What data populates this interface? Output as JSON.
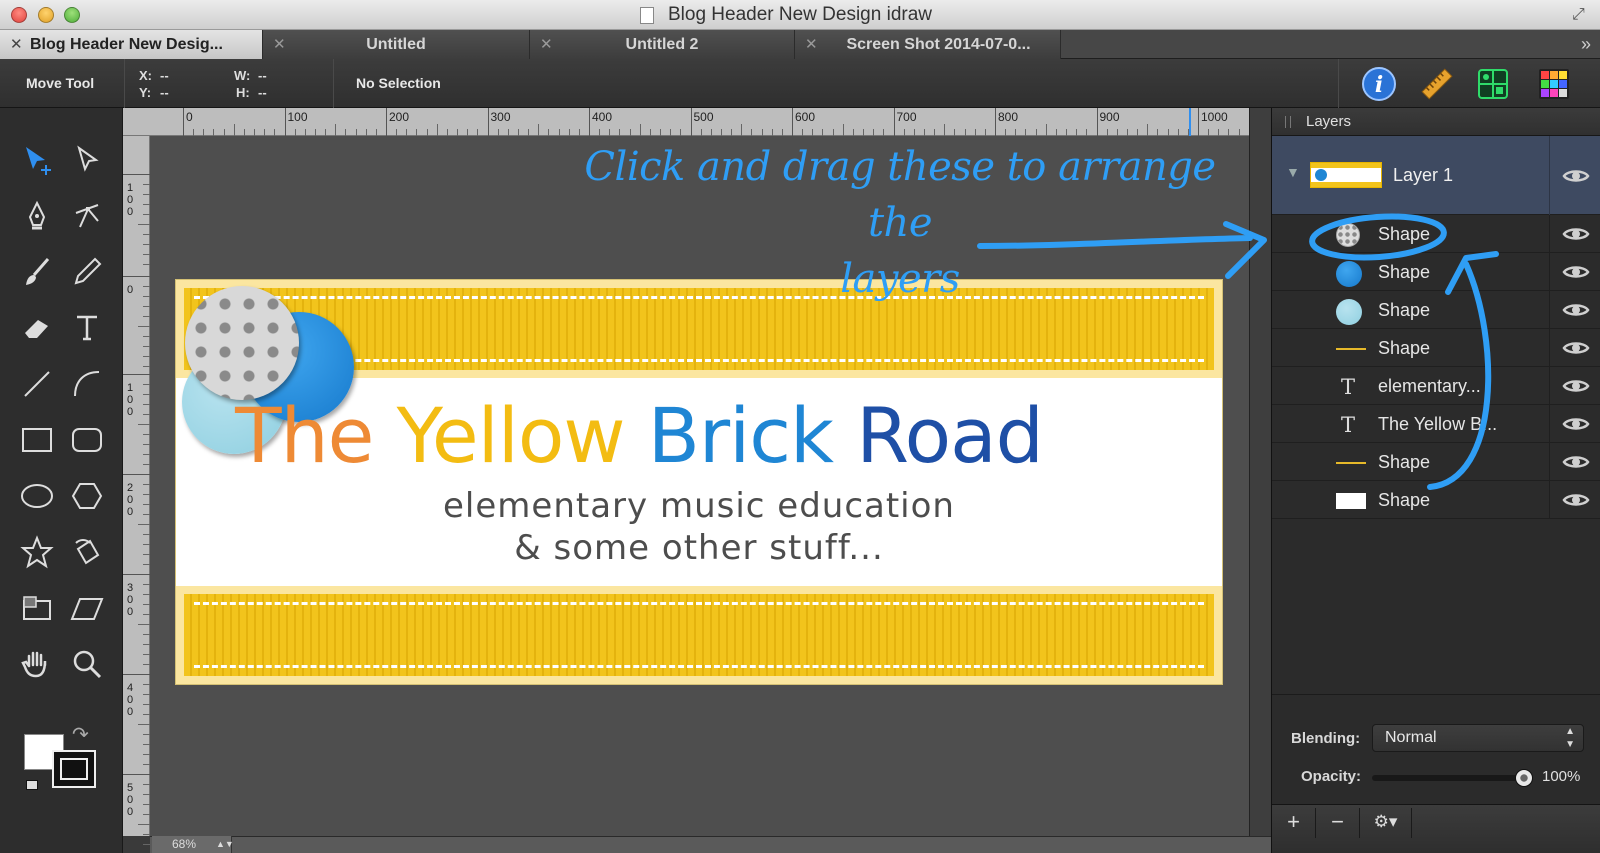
{
  "window": {
    "title": "Blog Header New Design idraw"
  },
  "tabs": [
    {
      "label": "Blog Header New Desig...",
      "active": true
    },
    {
      "label": "Untitled",
      "active": false
    },
    {
      "label": "Untitled 2",
      "active": false
    },
    {
      "label": "Screen Shot 2014-07-0...",
      "active": false
    }
  ],
  "toolbar": {
    "tool_name": "Move Tool",
    "x_label": "X:",
    "x_value": "--",
    "y_label": "Y:",
    "y_value": "--",
    "w_label": "W:",
    "w_value": "--",
    "h_label": "H:",
    "h_value": "--",
    "selection_status": "No Selection",
    "icons": [
      "info-icon",
      "ruler-icon",
      "grid-icon",
      "color-swatches-icon"
    ]
  },
  "ruler": {
    "top_labels": [
      "0",
      "100",
      "200",
      "300",
      "400",
      "500",
      "600",
      "700",
      "800",
      "900",
      "1000"
    ],
    "left_labels": [
      "1\n0\n0",
      "0",
      "1\n0\n0",
      "2\n0\n0",
      "3\n0\n0",
      "4\n0\n0",
      "5\n0\n0"
    ]
  },
  "zoom": {
    "value": "68%"
  },
  "artwork": {
    "headline": [
      {
        "text": "The ",
        "color": "#ee8a35"
      },
      {
        "text": "Yellow ",
        "color": "#f3bc12"
      },
      {
        "text": "Brick ",
        "color": "#1f86d4"
      },
      {
        "text": "Road",
        "color": "#1e4fa6"
      }
    ],
    "subtitle_line1": "elementary music education",
    "subtitle_line2": "& some other stuff..."
  },
  "annotation": {
    "line1": "Click and drag these to arrange the",
    "line2": "layers"
  },
  "layers_panel": {
    "title": "Layers",
    "group": {
      "name": "Layer 1"
    },
    "items": [
      {
        "name": "Shape",
        "thumb": "polka-circle"
      },
      {
        "name": "Shape",
        "thumb": "blue-circle"
      },
      {
        "name": "Shape",
        "thumb": "light-blue-circle"
      },
      {
        "name": "Shape",
        "thumb": "yellow-line"
      },
      {
        "name": "elementary...",
        "thumb": "text"
      },
      {
        "name": "The Yellow B...",
        "thumb": "text"
      },
      {
        "name": "Shape",
        "thumb": "yellow-line"
      },
      {
        "name": "Shape",
        "thumb": "white-rect"
      }
    ],
    "blending_label": "Blending:",
    "blending_value": "Normal",
    "opacity_label": "Opacity:",
    "opacity_value": "100%",
    "opacity_fraction": 1.0,
    "footer_buttons": [
      "+",
      "−",
      "⚙▾"
    ]
  },
  "colors": {
    "accent_blue": "#2f9ef5",
    "band_yellow": "#f2c41c",
    "selection_row": "#3e4a61"
  }
}
